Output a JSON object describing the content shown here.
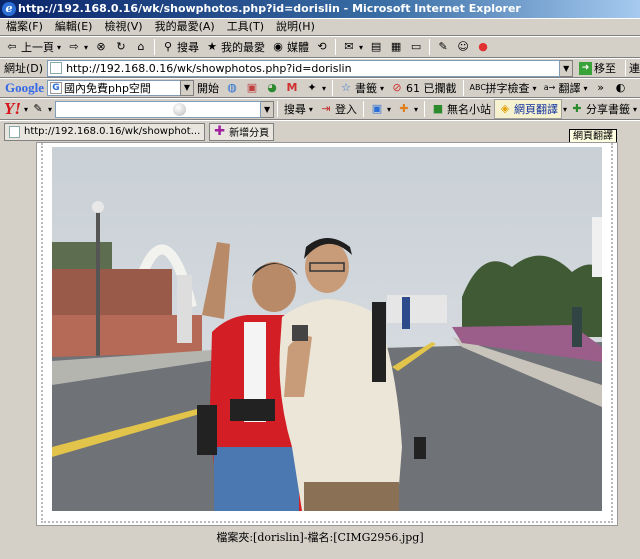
{
  "window": {
    "title": "http://192.168.0.16/wk/showphotos.php?id=dorislin - Microsoft Internet Explorer"
  },
  "menu": [
    "檔案(F)",
    "編輯(E)",
    "檢視(V)",
    "我的最愛(A)",
    "工具(T)",
    "說明(H)"
  ],
  "toolbar": {
    "back": "上一頁",
    "search": "搜尋",
    "favorites": "我的最愛",
    "media": "媒體"
  },
  "address": {
    "label": "網址(D)",
    "url": "http://192.168.0.16/wk/showphotos.php?id=dorislin",
    "go": "移至",
    "links": "連"
  },
  "google": {
    "logo": "Google",
    "query": "國內免費php空間",
    "open": "開始",
    "bookmarks": "書籤",
    "blocked": "61 已攔截",
    "spellcheck": "拼字檢查",
    "translate": "翻譯"
  },
  "yahoo": {
    "logo": "Y!",
    "search": "搜尋",
    "login": "登入",
    "site": "無名小站",
    "page_translate": "網頁翻譯",
    "share": "分享書籤"
  },
  "tabs": [
    {
      "label": "http://192.168.0.16/wk/showphot..."
    },
    {
      "label": "新增分頁"
    }
  ],
  "tooltip": "網頁翻譯",
  "caption": "檔案夾:[dorislin]-檔名:[CIMG2956.jpg]"
}
